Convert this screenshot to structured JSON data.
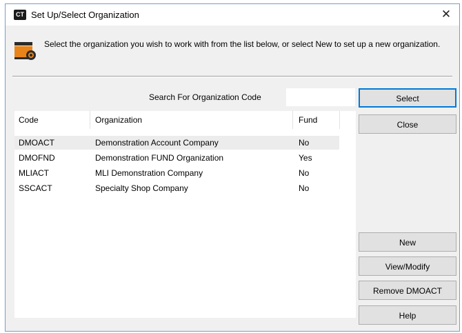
{
  "window": {
    "title": "Set Up/Select Organization",
    "app_icon_text": "CT",
    "close_glyph": "✕"
  },
  "instructions": "Select the organization you wish to work with from the list below, or select New to set up a new organization.",
  "search": {
    "label": "Search For Organization Code",
    "value": "",
    "placeholder": ""
  },
  "table": {
    "columns": [
      "Code",
      "Organization",
      "Fund"
    ],
    "rows": [
      {
        "code": "DMOACT",
        "organization": "Demonstration Account Company",
        "fund": "No",
        "selected": true
      },
      {
        "code": "DMOFND",
        "organization": "Demonstration FUND Organization",
        "fund": "Yes",
        "selected": false
      },
      {
        "code": "MLIACT",
        "organization": "MLI Demonstration Company",
        "fund": "No",
        "selected": false
      },
      {
        "code": "SSCACT",
        "organization": "Specialty Shop Company",
        "fund": "No",
        "selected": false
      }
    ]
  },
  "buttons": {
    "select": "Select",
    "close": "Close",
    "new": "New",
    "view_modify": "View/Modify",
    "remove": "Remove DMOACT",
    "help": "Help"
  },
  "colors": {
    "default_button_border": "#0078d7",
    "selected_row": "#ececec",
    "icon_orange": "#e8841a"
  },
  "icons": {
    "app": "ct-app-icon",
    "instruction": "organization-setup-icon",
    "close": "close-icon"
  }
}
